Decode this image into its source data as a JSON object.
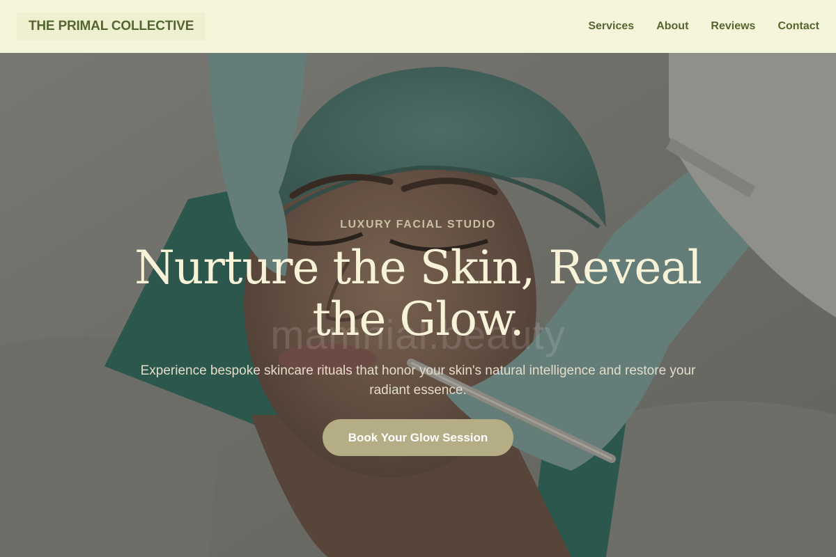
{
  "header": {
    "brand": "THE PRIMAL COLLECTIVE",
    "nav": [
      "Services",
      "About",
      "Reviews",
      "Contact"
    ]
  },
  "hero": {
    "eyebrow": "LUXURY FACIAL STUDIO",
    "headline": "Nurture the Skin, Reveal the Glow.",
    "watermark": "mamnial.beauty",
    "subtext": "Experience bespoke skincare rituals that honor your skin's natural intelligence and restore your radiant essence.",
    "cta": "Book Your Glow Session"
  },
  "colors": {
    "header_bg": "#f5f5dc",
    "brand_text": "#55652f",
    "cta_bg": "#b4ad86",
    "headline": "#f8f3d8"
  }
}
